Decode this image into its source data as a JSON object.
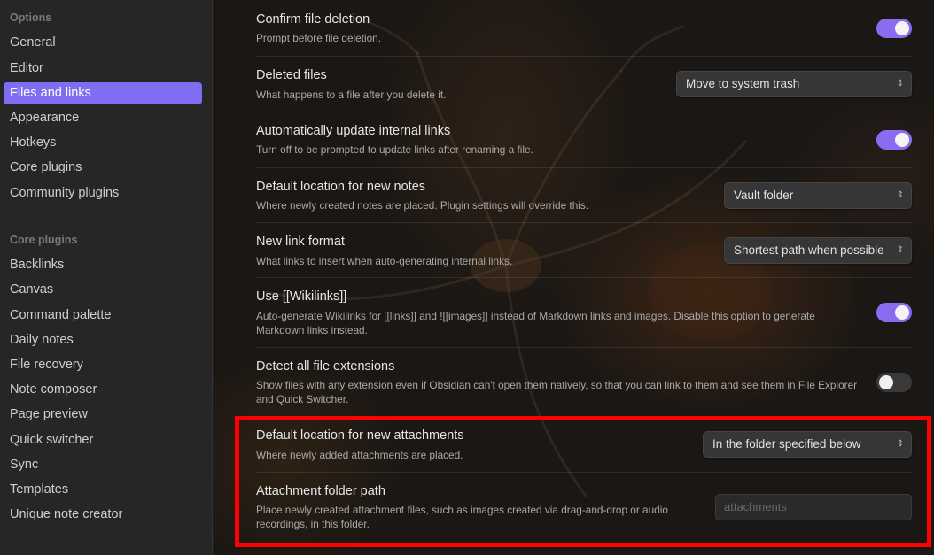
{
  "sidebar": {
    "options_heading": "Options",
    "options_items": [
      "General",
      "Editor",
      "Files and links",
      "Appearance",
      "Hotkeys",
      "Core plugins",
      "Community plugins"
    ],
    "core_heading": "Core plugins",
    "core_items": [
      "Backlinks",
      "Canvas",
      "Command palette",
      "Daily notes",
      "File recovery",
      "Note composer",
      "Page preview",
      "Quick switcher",
      "Sync",
      "Templates",
      "Unique note creator"
    ]
  },
  "settings": [
    {
      "name": "Confirm file deletion",
      "desc": "Prompt before file deletion.",
      "control": "toggle",
      "on": true
    },
    {
      "name": "Deleted files",
      "desc": "What happens to a file after you delete it.",
      "control": "dropdown",
      "value": "Move to system trash"
    },
    {
      "name": "Automatically update internal links",
      "desc": "Turn off to be prompted to update links after renaming a file.",
      "control": "toggle",
      "on": true
    },
    {
      "name": "Default location for new notes",
      "desc": "Where newly created notes are placed. Plugin settings will override this.",
      "control": "dropdown",
      "value": "Vault folder"
    },
    {
      "name": "New link format",
      "desc": "What links to insert when auto-generating internal links.",
      "control": "dropdown",
      "value": "Shortest path when possible"
    },
    {
      "name": "Use [[Wikilinks]]",
      "desc": "Auto-generate Wikilinks for [[links]] and ![[images]] instead of Markdown links and images. Disable this option to generate Markdown links instead.",
      "control": "toggle",
      "on": true
    },
    {
      "name": "Detect all file extensions",
      "desc": "Show files with any extension even if Obsidian can't open them natively, so that you can link to them and see them in File Explorer and Quick Switcher.",
      "control": "toggle",
      "on": false
    },
    {
      "name": "Default location for new attachments",
      "desc": "Where newly added attachments are placed.",
      "control": "dropdown",
      "value": "In the folder specified below"
    },
    {
      "name": "Attachment folder path",
      "desc": "Place newly created attachment files, such as images created via drag-and-drop or audio recordings, in this folder.",
      "control": "text",
      "placeholder": "attachments"
    }
  ],
  "icons": {
    "chevron": "chevron-up-down-icon"
  },
  "colors": {
    "accent": "#7f6df2",
    "highlight": "#ff0000"
  }
}
